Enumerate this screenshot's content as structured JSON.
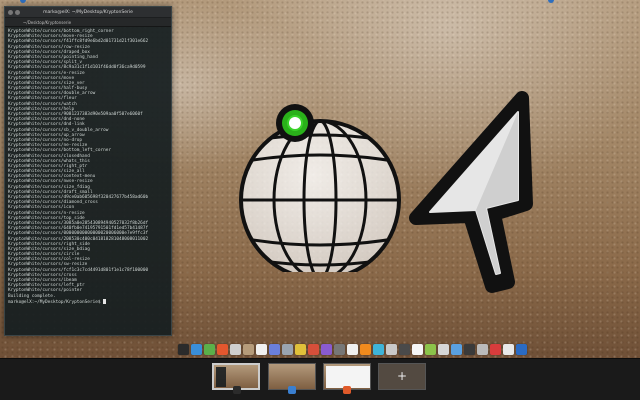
{
  "terminal": {
    "title": "marko@elX: ~/MyDesktop/KryptonSerie",
    "tab_label": "~/Desktop/Kryptonserie",
    "lines": [
      "KryptonWhite/cursors/bottom_right_corner",
      "KryptonWhite/cursors/move-resize",
      "KryptonWhite/cursors/f41ffc8fd9e6bd2d01731d21f301e662",
      "KryptonWhite/cursors/row-resize",
      "KryptonWhite/cursors/draped_box",
      "KryptonWhite/cursors/pointing_hand",
      "KryptonWhite/cursors/split_v",
      "KryptonWhite/cursors/8c9a31c1f1d101f46dd0f36ca9d0599",
      "KryptonWhite/cursors/e-resize",
      "KryptonWhite/cursors/move",
      "KryptonWhite/cursors/size_ver",
      "KryptonWhite/cursors/half-busy",
      "KryptonWhite/cursors/double_arrow",
      "KryptonWhite/cursors/fleur",
      "KryptonWhite/cursors/watch",
      "KryptonWhite/cursors/help",
      "KryptonWhite/cursors/9081237383d90e509aa0f507e6060f",
      "KryptonWhite/cursors/dnd-none",
      "KryptonWhite/cursors/dnd-link",
      "KryptonWhite/cursors/sb_v_double_arrow",
      "KryptonWhite/cursors/up_arrow",
      "KryptonWhite/cursors/no-drop",
      "KryptonWhite/cursors/ne-resize",
      "KryptonWhite/cursors/bottom_left_corner",
      "KryptonWhite/cursors/closedhand",
      "KryptonWhite/cursors/whats_this",
      "KryptonWhite/cursors/right_ptr",
      "KryptonWhite/cursors/size_all",
      "KryptonWhite/cursors/context-menu",
      "KryptonWhite/cursors/nwse-resize",
      "KryptonWhite/cursors/size_fdiag",
      "KryptonWhite/cursors/draft_small",
      "KryptonWhite/cursors/d9ce0ab605698f320427677b458ad60b",
      "KryptonWhite/cursors/diamond_cross",
      "KryptonWhite/cursors/icon",
      "KryptonWhite/cursors/n-resize",
      "KryptonWhite/cursors/top_side",
      "KryptonWhite/cursors/3085a0e285430894940527032f8b26df",
      "KryptonWhite/cursors/640fb0e74195791501fd1ed57b41487f",
      "KryptonWhite/cursors/00000000000000020006000e7e9ffc3f",
      "KryptonWhite/cursors/208530c400c041818281048008011002",
      "KryptonWhite/cursors/right_side",
      "KryptonWhite/cursors/size_bdiag",
      "KryptonWhite/cursors/circle",
      "KryptonWhite/cursors/col-resize",
      "KryptonWhite/cursors/sw-resize",
      "KryptonWhite/cursors/fcf1c3c7cd4491d801f1e1c78f100000",
      "KryptonWhite/cursors/cross",
      "KryptonWhite/cursors/ibeam",
      "KryptonWhite/cursors/left_ptr",
      "KryptonWhite/cursors/pointer",
      "Building complete."
    ],
    "prompt": "marko@elX:~/MyDesktop/KryptonSerie$ "
  },
  "dock": {
    "icons": [
      {
        "name": "terminal-icon",
        "color": "#2b2b2b"
      },
      {
        "name": "files-icon",
        "color": "#3a8ed8"
      },
      {
        "name": "settings-icon",
        "color": "#5bb04a"
      },
      {
        "name": "browser-icon",
        "color": "#e4572e"
      },
      {
        "name": "image-viewer-icon",
        "color": "#cfcfcf"
      },
      {
        "name": "photo-icon",
        "color": "#b59b7a"
      },
      {
        "name": "mail-icon",
        "color": "#f0f0f0"
      },
      {
        "name": "chat-icon",
        "color": "#6a7fdb"
      },
      {
        "name": "app-grid-icon",
        "color": "#9aa4b0"
      },
      {
        "name": "media-icon",
        "color": "#e0c03a"
      },
      {
        "name": "rocket-icon",
        "color": "#d64f3a"
      },
      {
        "name": "game-icon",
        "color": "#8a5bd0"
      },
      {
        "name": "archive-icon",
        "color": "#777777"
      },
      {
        "name": "office-icon",
        "color": "#f0f0f0"
      },
      {
        "name": "vlc-icon",
        "color": "#f08a1d"
      },
      {
        "name": "globe-icon",
        "color": "#3fb4d8"
      },
      {
        "name": "tools-icon",
        "color": "#c9c9c9"
      },
      {
        "name": "editor-icon",
        "color": "#4a4a4a"
      },
      {
        "name": "calendar-icon",
        "color": "#f6f6f6"
      },
      {
        "name": "android-icon",
        "color": "#8cc34a"
      },
      {
        "name": "music-icon",
        "color": "#d6d6d6"
      },
      {
        "name": "cloud-icon",
        "color": "#5aa0e0"
      },
      {
        "name": "text-icon",
        "color": "#3a3a3a"
      },
      {
        "name": "camera-icon",
        "color": "#bbbbbb"
      },
      {
        "name": "red-app-icon",
        "color": "#d83c3c"
      },
      {
        "name": "mail-client-icon",
        "color": "#e8e8e8"
      },
      {
        "name": "store-icon",
        "color": "#2a6bc4"
      }
    ]
  },
  "workspaces": {
    "add_label": "+",
    "thumbs": [
      {
        "name": "workspace-1",
        "active": true,
        "badge_color": "#2b2b2b"
      },
      {
        "name": "workspace-2",
        "active": false,
        "badge_color": "#3a7fd0"
      },
      {
        "name": "workspace-3",
        "active": false,
        "badge_color": "#e05a2a"
      }
    ]
  },
  "colors": {
    "accent": "#2e6fbf",
    "cursor_dot": "#2ab11a"
  }
}
